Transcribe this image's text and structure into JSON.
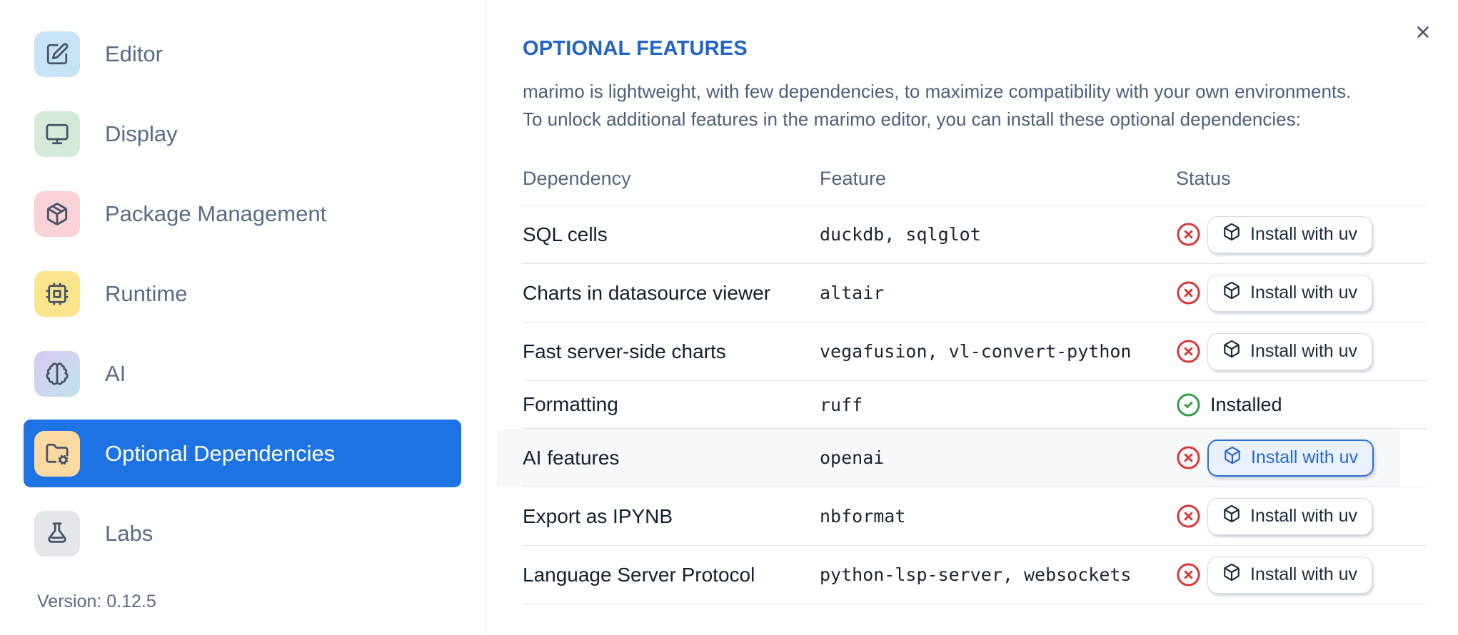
{
  "sidebar": {
    "items": [
      {
        "label": "Editor",
        "icon": "edit-icon",
        "tile_color": "#c7e3f5",
        "selected": false
      },
      {
        "label": "Display",
        "icon": "monitor-icon",
        "tile_color": "#d3ead9",
        "selected": false
      },
      {
        "label": "Package Management",
        "icon": "package-icon",
        "tile_color": "#f9d1d6",
        "selected": false
      },
      {
        "label": "Runtime",
        "icon": "cpu-icon",
        "tile_color": "#fbe58c",
        "selected": false
      },
      {
        "label": "AI",
        "icon": "brain-icon",
        "tile_color": "gradient-purple-cyan",
        "selected": false
      },
      {
        "label": "Optional Dependencies",
        "icon": "folder-cog-icon",
        "tile_color": "#fcd9a0",
        "selected": true
      },
      {
        "label": "Labs",
        "icon": "flask-icon",
        "tile_color": "#e4e6e9",
        "selected": false
      }
    ],
    "version_label": "Version: 0.12.5"
  },
  "panel": {
    "title": "OPTIONAL FEATURES",
    "description_lines": [
      "marimo is lightweight, with few dependencies, to maximize compatibility with your own environments.",
      "To unlock additional features in the marimo editor, you can install these optional dependencies:"
    ],
    "close_icon": "x-icon",
    "table": {
      "columns": [
        "Dependency",
        "Feature",
        "Status"
      ],
      "rows": [
        {
          "dependency": "SQL cells",
          "feature": "duckdb, sqlglot",
          "status": "not installed",
          "status_icon": "circle-x-icon",
          "action": "Install with uv",
          "button_icon": "box-icon",
          "highlighted": false
        },
        {
          "dependency": "Charts in datasource viewer",
          "feature": "altair",
          "status": "not installed",
          "status_icon": "circle-x-icon",
          "action": "Install with uv",
          "button_icon": "box-icon",
          "highlighted": false
        },
        {
          "dependency": "Fast server-side charts",
          "feature": "vegafusion, vl-convert-python",
          "status": "not installed",
          "status_icon": "circle-x-icon",
          "action": "Install with uv",
          "button_icon": "box-icon",
          "highlighted": false
        },
        {
          "dependency": "Formatting",
          "feature": "ruff",
          "status": "installed",
          "status_icon": "circle-check-icon",
          "status_label": "Installed",
          "highlighted": false
        },
        {
          "dependency": "AI features",
          "feature": "openai",
          "status": "not installed",
          "status_icon": "circle-x-icon",
          "action": "Install with uv",
          "button_icon": "box-icon",
          "highlighted": true
        },
        {
          "dependency": "Export as IPYNB",
          "feature": "nbformat",
          "status": "not installed",
          "status_icon": "circle-x-icon",
          "action": "Install with uv",
          "button_icon": "box-icon",
          "highlighted": false
        },
        {
          "dependency": "Language Server Protocol",
          "feature": "python-lsp-server, websockets",
          "status": "not installed",
          "status_icon": "circle-x-icon",
          "action": "Install with uv",
          "button_icon": "box-icon",
          "highlighted": false
        }
      ]
    }
  },
  "colors": {
    "selected_item_bg": "#1d73e3",
    "title_blue": "#2264c8",
    "error_red": "#dc3434",
    "success_green": "#2f9e44",
    "highlight_button_border": "#2e6fd6",
    "highlight_button_bg": "#e9f2fc",
    "row_highlight_bg": "#f7f8fa",
    "table_border": "#dee4ee"
  }
}
